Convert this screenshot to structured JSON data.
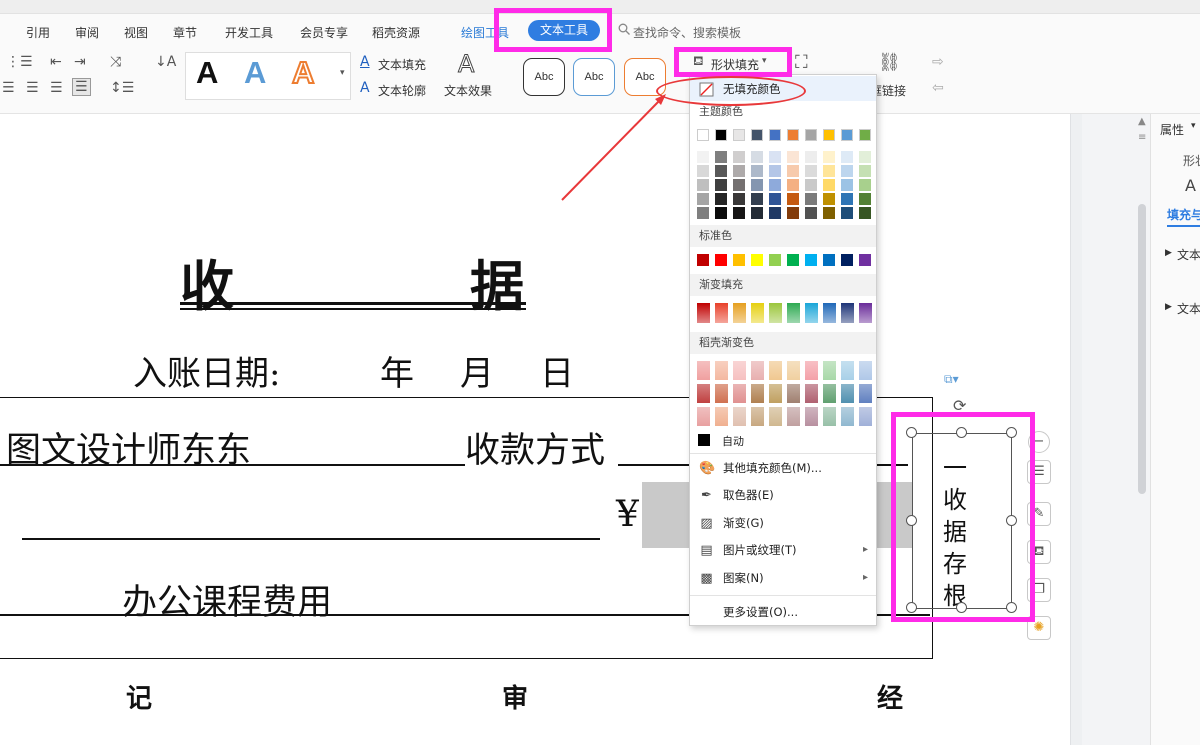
{
  "menu": {
    "items": [
      "引用",
      "审阅",
      "视图",
      "章节",
      "开发工具",
      "会员专享",
      "稻壳资源"
    ],
    "drawing_tool_tab": "绘图工具",
    "text_tool_tab": "文本工具",
    "search_placeholder": "查找命令、搜索模板"
  },
  "ribbon": {
    "art_letters": [
      "A",
      "A",
      "A"
    ],
    "text_fill": "文本填充",
    "text_outline": "文本轮廓",
    "text_effect": "文本效果",
    "shape_styles": [
      "Abc",
      "Abc",
      "Abc"
    ],
    "shape_fill": "形状填充",
    "frame_link": "框链接"
  },
  "properties_panel": {
    "title": "属性",
    "shape_tab": "形状",
    "fill_tab": "填充与",
    "section1": "文本",
    "section2": "文本"
  },
  "colors": {
    "accent_blue": "#2f7de1",
    "highlight_magenta": "#ff2be8",
    "annotation_red": "#e8383a"
  },
  "dropdown": {
    "no_fill": "无填充颜色",
    "theme_colors_label": "主题颜色",
    "standard_colors_label": "标准色",
    "gradient_fill_label": "渐变填充",
    "docer_gradient_label": "稻壳渐变色",
    "auto": "自动",
    "more_fill_colors": "其他填充颜色(M)...",
    "eyedropper": "取色器(E)",
    "gradient": "渐变(G)",
    "picture_texture": "图片或纹理(T)",
    "pattern": "图案(N)",
    "more_settings": "更多设置(O)...",
    "theme_top": [
      "#ffffff",
      "#000000",
      "#e7e6e6",
      "#44546a",
      "#4472c4",
      "#ed7d31",
      "#a5a5a5",
      "#ffc000",
      "#5b9bd5",
      "#70ad47"
    ],
    "theme_shades": [
      [
        "#f2f2f2",
        "#7f7f7f",
        "#d0cece",
        "#d6dce4",
        "#d9e2f3",
        "#fbe5d5",
        "#ededed",
        "#fff2cc",
        "#deeaf6",
        "#e2efd9"
      ],
      [
        "#d8d8d8",
        "#595959",
        "#aeaaaa",
        "#adb9ca",
        "#b4c6e7",
        "#f7caac",
        "#dbdbdb",
        "#ffe599",
        "#bdd6ee",
        "#c5e0b3"
      ],
      [
        "#bfbfbf",
        "#3f3f3f",
        "#747070",
        "#8496b0",
        "#8eaadb",
        "#f4b083",
        "#c9c9c9",
        "#ffd966",
        "#9cc3e5",
        "#a8d08d"
      ],
      [
        "#a5a5a5",
        "#262626",
        "#3a3838",
        "#323e4f",
        "#2f5496",
        "#c55a11",
        "#7b7b7b",
        "#bf9000",
        "#2e75b5",
        "#538135"
      ],
      [
        "#7f7f7f",
        "#0c0c0c",
        "#171616",
        "#222a35",
        "#1f3864",
        "#833c0b",
        "#525252",
        "#7f6000",
        "#1e4e79",
        "#375623"
      ]
    ],
    "standard": [
      "#c00000",
      "#ff0000",
      "#ffc000",
      "#ffff00",
      "#92d050",
      "#00b050",
      "#00b0f0",
      "#0070c0",
      "#002060",
      "#7030a0"
    ],
    "gradient_colors": [
      "#c00000",
      "#e8402a",
      "#e6a020",
      "#e6d010",
      "#9bc63c",
      "#2eaa52",
      "#1aa6d8",
      "#1f68b8",
      "#1e3478",
      "#6a2c9a"
    ],
    "docer_rows": [
      [
        "#f0a0a0",
        "#f4b8a0",
        "#f6c0c0",
        "#e8b0b0",
        "#f0c890",
        "#f0d0a0",
        "#f4a0a8",
        "#a8d8a8",
        "#a8d0e8",
        "#b0c8e8"
      ],
      [
        "#c04040",
        "#d07050",
        "#e09090",
        "#b08050",
        "#c0a060",
        "#a08070",
        "#b06070",
        "#60a070",
        "#5090b0",
        "#6080c0"
      ],
      [
        "#e8a0a0",
        "#f0b090",
        "#e0c0b0",
        "#c8a880",
        "#d0b890",
        "#c0a0a0",
        "#b890a0",
        "#98c0a8",
        "#90b8d0",
        "#a0b0d8"
      ]
    ]
  },
  "document": {
    "title_left": "收",
    "title_right": "据",
    "date_label": "入账日期:",
    "year": "年",
    "month": "月",
    "day": "日",
    "payer": "图文设计师东东",
    "payment_method": "收款方式",
    "yuan_sign": "¥",
    "purpose": "办公课程费用",
    "footer": [
      "记",
      "审",
      "经"
    ],
    "vertical_text": [
      "一",
      "收",
      "据",
      "存",
      "根"
    ]
  }
}
